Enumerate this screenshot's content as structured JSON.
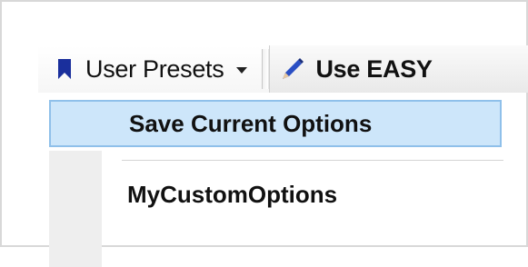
{
  "toolbar": {
    "presets_label": "User Presets",
    "presets_icon": "bookmark-icon",
    "easy_label": "Use EASY",
    "easy_icon": "pencil-icon"
  },
  "menu": {
    "items": [
      {
        "label": "Save Current Options",
        "highlighted": true
      },
      {
        "label": "MyCustomOptions",
        "highlighted": false
      }
    ]
  },
  "colors": {
    "highlight_bg": "#cde6fa",
    "highlight_border": "#8fc0ea",
    "bookmark_blue": "#1a2f9c",
    "pencil_blue": "#2a4fc4"
  }
}
